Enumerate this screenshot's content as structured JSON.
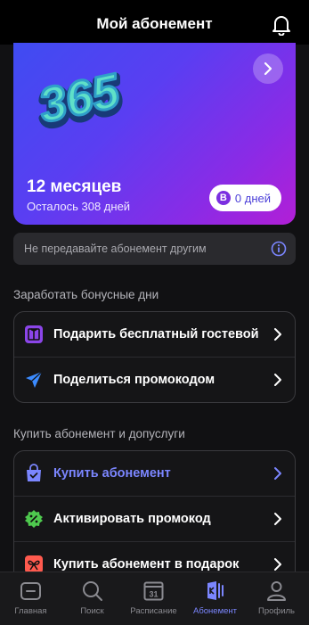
{
  "header": {
    "title": "Мой абонемент"
  },
  "card": {
    "logo_text": "365",
    "months": "12 месяцев",
    "remaining": "Осталось 308 дней",
    "bonus_badge_letter": "B",
    "bonus_days": "0 дней"
  },
  "notice": {
    "text": "Не передавайте абонемент другим"
  },
  "bonus_section": {
    "title": "Заработать бонусные дни",
    "items": [
      {
        "label": "Подарить бесплатный гостевой",
        "icon": "gift-icon"
      },
      {
        "label": "Поделиться промокодом",
        "icon": "send-icon"
      }
    ]
  },
  "buy_section": {
    "title": "Купить абонемент и допуслуги",
    "items": [
      {
        "label": "Купить абонемент",
        "icon": "shopping-bag-icon",
        "color": "#7b86ff"
      },
      {
        "label": "Активировать промокод",
        "icon": "discount-icon"
      },
      {
        "label": "Купить абонемент в подарок",
        "icon": "present-icon"
      }
    ]
  },
  "tabbar": {
    "items": [
      {
        "label": "Главная",
        "icon": "home-icon"
      },
      {
        "label": "Поиск",
        "icon": "search-icon"
      },
      {
        "label": "Расписание",
        "icon": "calendar-icon",
        "calendar_day": "31"
      },
      {
        "label": "Абонемент",
        "icon": "membership-icon",
        "active": true
      },
      {
        "label": "Профиль",
        "icon": "profile-icon"
      }
    ]
  },
  "colors": {
    "accent": "#7b86ff",
    "card_gradient_start": "#3f4cf2",
    "card_gradient_end": "#b21fd6",
    "gift_icon": "#8b45e8",
    "discount_icon": "#4ec94e",
    "present_icon": "#ff5a4e"
  }
}
